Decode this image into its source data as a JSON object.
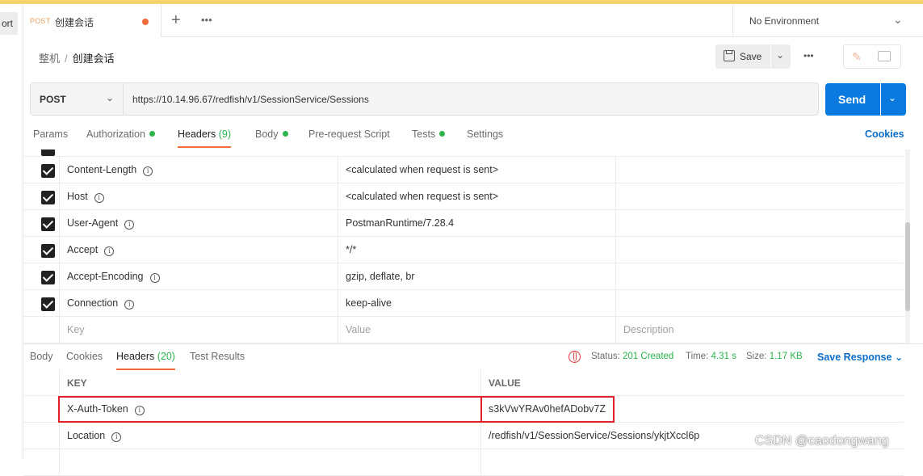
{
  "left_stub": {
    "label": "ort"
  },
  "tab": {
    "method": "POST",
    "name": "创建会话"
  },
  "environment": {
    "label": "No Environment"
  },
  "breadcrumb": {
    "parent": "整机",
    "separator": "/",
    "current": "创建会话"
  },
  "toolbar": {
    "save_label": "Save"
  },
  "request": {
    "method": "POST",
    "url": "https://10.14.96.67/redfish/v1/SessionService/Sessions",
    "send_label": "Send"
  },
  "request_tabs": [
    {
      "label": "Params"
    },
    {
      "label": "Authorization"
    },
    {
      "label": "Headers",
      "count": "(9)"
    },
    {
      "label": "Body"
    },
    {
      "label": "Pre-request Script"
    },
    {
      "label": "Tests"
    },
    {
      "label": "Settings"
    }
  ],
  "cookies_label": "Cookies",
  "request_headers": [
    {
      "key": "Content-Length",
      "value": "<calculated when request is sent>"
    },
    {
      "key": "Host",
      "value": "<calculated when request is sent>"
    },
    {
      "key": "User-Agent",
      "value": "PostmanRuntime/7.28.4"
    },
    {
      "key": "Accept",
      "value": "*/*"
    },
    {
      "key": "Accept-Encoding",
      "value": "gzip, deflate, br"
    },
    {
      "key": "Connection",
      "value": "keep-alive"
    }
  ],
  "new_header_placeholders": {
    "key": "Key",
    "value": "Value",
    "description": "Description"
  },
  "response_tabs": [
    {
      "label": "Body"
    },
    {
      "label": "Cookies"
    },
    {
      "label": "Headers",
      "count": "(20)"
    },
    {
      "label": "Test Results"
    }
  ],
  "response_status": {
    "status_label": "Status:",
    "status_value": "201 Created",
    "time_label": "Time:",
    "time_value": "4.31 s",
    "size_label": "Size:",
    "size_value": "1.17 KB",
    "save_response_label": "Save Response"
  },
  "response_headers_columns": {
    "key": "KEY",
    "value": "VALUE"
  },
  "response_headers": [
    {
      "key": "X-Auth-Token",
      "value": "s3kVwYRAv0hefADobv7Z"
    },
    {
      "key": "Location",
      "value": "/redfish/v1/SessionService/Sessions/ykjtXccl6p"
    }
  ],
  "watermark": "CSDN @caodongwang",
  "colors": {
    "accent_orange": "#f26b3a",
    "send_blue": "#0b7ae0",
    "status_green": "#2bb34c",
    "highlight_red": "#e0202a"
  }
}
